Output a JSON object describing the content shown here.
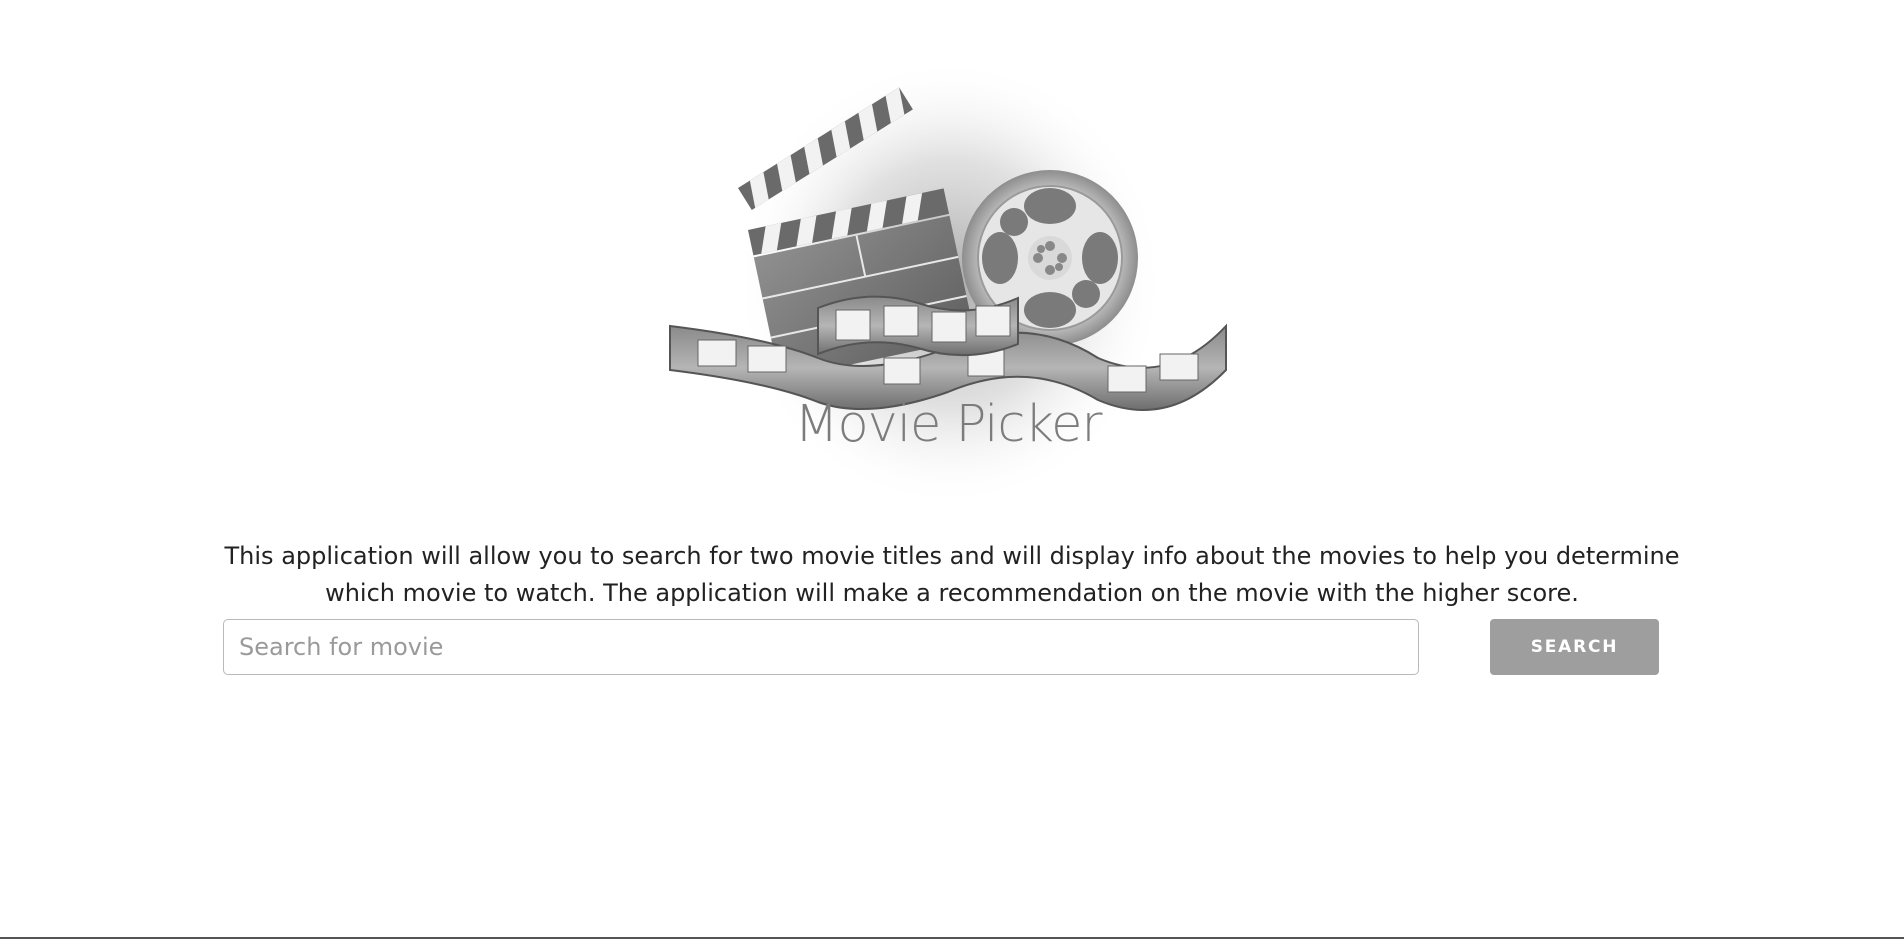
{
  "logo": {
    "title": "Movie Picker",
    "icon": "clapperboard-film-reel-icon"
  },
  "intro": {
    "description": "This application will allow you to search for two movie titles and will display info about the movies to help you determine which movie to watch. The application will make a recommendation on the movie with the higher score."
  },
  "search": {
    "placeholder": "Search for movie",
    "value": "",
    "button_label": "SEARCH"
  },
  "colors": {
    "button_bg": "#9e9e9e",
    "logo_gray": "#7c7c7c",
    "text": "#222222"
  }
}
